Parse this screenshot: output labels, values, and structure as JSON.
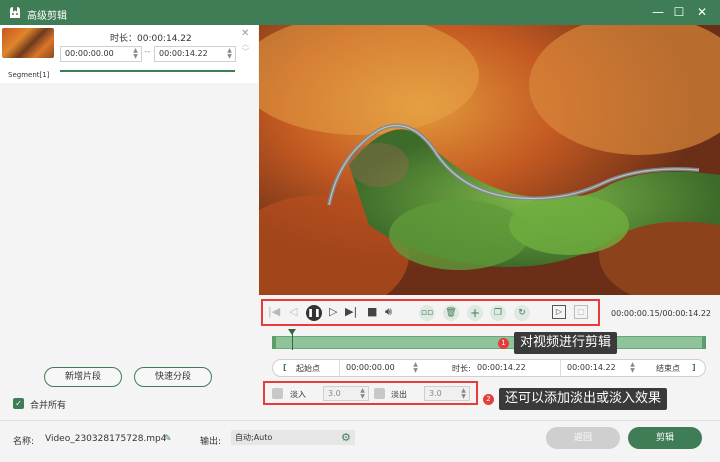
{
  "window": {
    "title": "高级剪辑",
    "controls": [
      "—",
      "☐",
      "✕"
    ]
  },
  "segment": {
    "label": "Segment[1]",
    "duration_label": "时长：00:00:14.22",
    "start_time": "00:00:00.00",
    "end_time": "00:00:14.22",
    "separator": "--"
  },
  "left_actions": {
    "add_segment": "新增片段",
    "quick_split": "快速分段",
    "merge_all": "合并所有"
  },
  "player": {
    "timecode": "00:00:00.15/00:00:14.22"
  },
  "trim": {
    "start_label": "起始点",
    "start_value": "00:00:00.00",
    "duration_label": "时长:",
    "duration_value": "00:00:14.22",
    "end_label": "结束点"
  },
  "fade": {
    "fade_in_label": "淡入",
    "fade_in_value": "3.0",
    "fade_out_label": "淡出",
    "fade_out_value": "3.0"
  },
  "annotations": {
    "note1_num": "1",
    "note1_text": "对视频进行剪辑",
    "note2_num": "2",
    "note2_text": "还可以添加淡出或淡入效果"
  },
  "footer": {
    "name_label": "名称:",
    "filename": "Video_230328175728.mp4",
    "output_label": "输出:",
    "output_value": "自动;Auto",
    "back_button": "返回",
    "edit_button": "剪辑"
  },
  "colors": {
    "brand_green": "#3f7d56",
    "annotation_red": "#e53d3d",
    "timeline_green": "#8fc49b"
  }
}
